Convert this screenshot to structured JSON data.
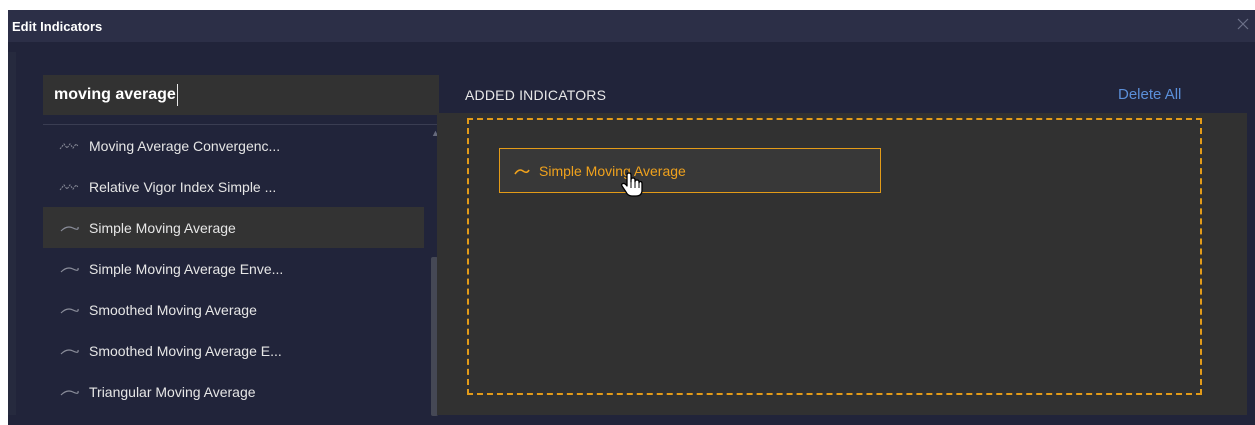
{
  "dialog": {
    "title": "Edit Indicators",
    "close_icon": "close-icon"
  },
  "search": {
    "value": "moving average"
  },
  "results": {
    "items": [
      {
        "label": "Moving Average Convergenc...",
        "icon": "zigzag-line-icon"
      },
      {
        "label": "Relative Vigor Index Simple ...",
        "icon": "zigzag-line-icon"
      },
      {
        "label": "Simple Moving Average",
        "icon": "curve-line-icon",
        "hovered": true
      },
      {
        "label": "Simple Moving Average Enve...",
        "icon": "curve-line-icon"
      },
      {
        "label": "Smoothed Moving Average",
        "icon": "curve-line-icon"
      },
      {
        "label": "Smoothed Moving Average E...",
        "icon": "curve-line-icon"
      },
      {
        "label": "Triangular Moving Average",
        "icon": "curve-line-icon"
      }
    ]
  },
  "added": {
    "header": "ADDED INDICATORS",
    "delete_all": "Delete All",
    "chips": [
      {
        "label": "Simple Moving Average",
        "icon": "curve-line-icon"
      }
    ]
  },
  "colors": {
    "accent": "#e39b18",
    "link": "#5b8fd9",
    "dialog_bg": "#21243a",
    "panel_bg": "#313131"
  }
}
